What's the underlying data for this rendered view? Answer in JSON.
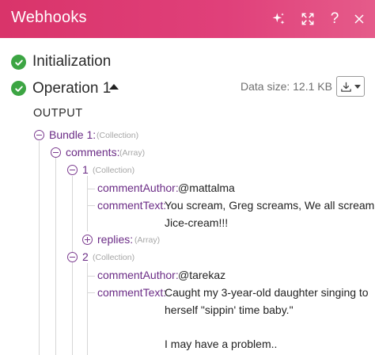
{
  "header": {
    "title": "Webhooks",
    "icons": [
      "sparkle-icon",
      "expand-icon",
      "help-icon",
      "close-icon"
    ],
    "help_label": "?"
  },
  "sections": {
    "initialization": {
      "label": "Initialization"
    },
    "operation": {
      "label": "Operation 1",
      "data_size": "Data size: 12.1 KB"
    }
  },
  "output": {
    "label": "OUTPUT",
    "bundle": {
      "key": "Bundle 1:",
      "type": "(Collection)"
    },
    "comments": {
      "key": "comments:",
      "type": "(Array)"
    },
    "items": [
      {
        "index": "1",
        "type": "(Collection)",
        "author_key": "commentAuthor:",
        "author": "@mattalma",
        "text_key": "commentText:",
        "text_lines": [
          "You scream, Greg screams, We all scream for",
          "Jice-cream!!!"
        ],
        "replies_key": "replies:",
        "replies_type": "(Array)"
      },
      {
        "index": "2",
        "type": "(Collection)",
        "author_key": "commentAuthor:",
        "author": "@tarekaz",
        "text_key": "commentText:",
        "text_lines": [
          "Caught my 3-year-old daughter singing to",
          "herself \"sippin' time baby.\"",
          "",
          "I may have a problem.."
        ]
      }
    ]
  },
  "colors": {
    "header_gradient_start": "#d9346a",
    "header_gradient_end": "#e55b8a",
    "success": "#3ca543",
    "key": "#6b2c86",
    "type_hint": "#a6a6a6"
  }
}
